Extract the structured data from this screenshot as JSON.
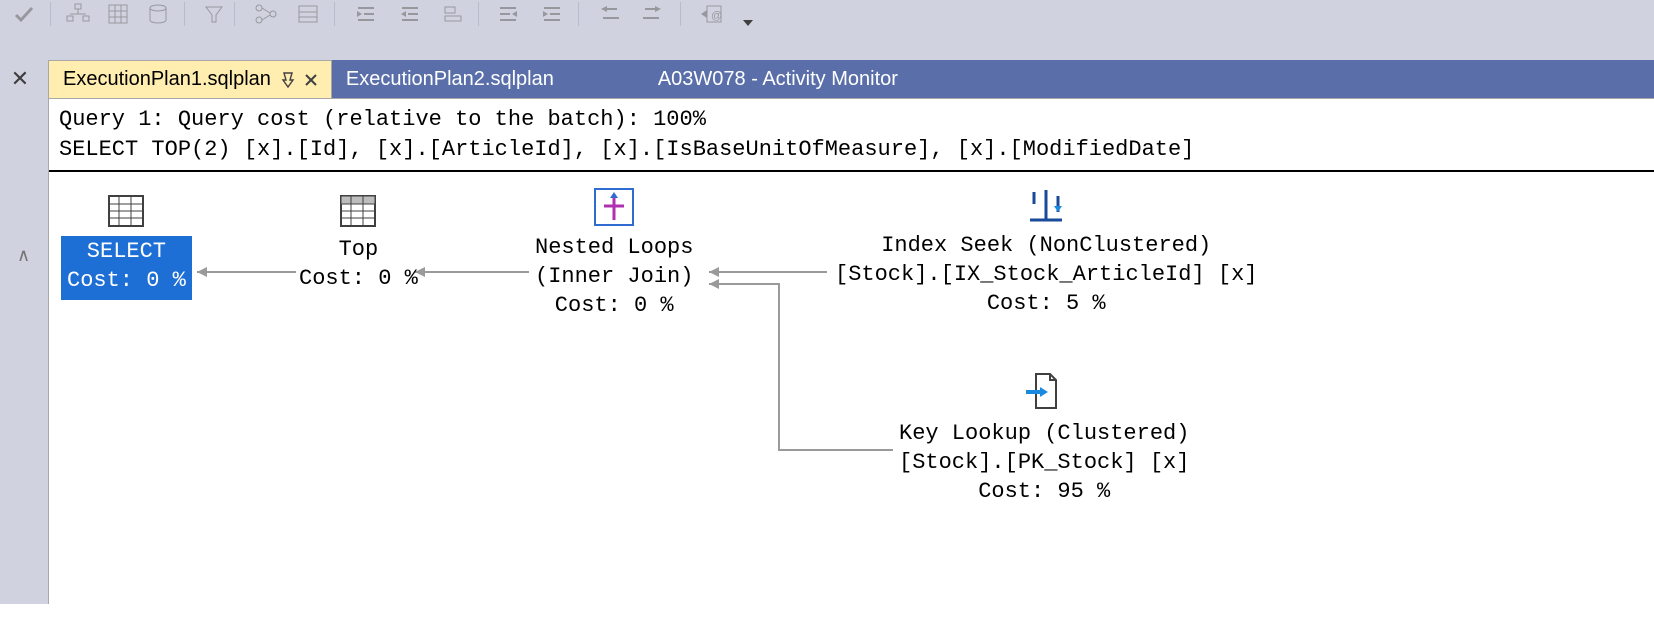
{
  "toolbar": {
    "icons": [
      "checkmark-icon",
      "hierarchy-icon",
      "grid-icon",
      "db-icon",
      "filter-icon",
      "tree-icon",
      "table-icon",
      "outdent-icon",
      "indent-icon",
      "align-left-icon",
      "align-right-icon",
      "arrow-left-small-icon",
      "arrow-right-small-icon",
      "arrow-right-circle-icon",
      "dropdown-caret-icon"
    ]
  },
  "tabs": [
    {
      "label": "ExecutionPlan1.sqlplan",
      "active": true,
      "pinned": true,
      "closable": true
    },
    {
      "label": "ExecutionPlan2.sqlplan",
      "active": false,
      "pinned": false,
      "closable": false
    },
    {
      "label": "A03W078 - Activity Monitor",
      "active": false,
      "pinned": false,
      "closable": false
    }
  ],
  "query": {
    "line1": "Query 1: Query cost (relative to the batch): 100%",
    "line2": "SELECT TOP(2) [x].[Id], [x].[ArticleId], [x].[IsBaseUnitOfMeasure], [x].[ModifiedDate]"
  },
  "nodes": {
    "select": {
      "title": "SELECT",
      "cost": "Cost: 0 %"
    },
    "top": {
      "title": "Top",
      "cost": "Cost: 0 %"
    },
    "nested": {
      "title": "Nested Loops",
      "sub": "(Inner Join)",
      "cost": "Cost: 0 %"
    },
    "indexseek": {
      "title": "Index Seek (NonClustered)",
      "obj": "[Stock].[IX_Stock_ArticleId] [x]",
      "cost": "Cost: 5 %"
    },
    "keylookup": {
      "title": "Key Lookup (Clustered)",
      "obj": "[Stock].[PK_Stock] [x]",
      "cost": "Cost: 95 %"
    }
  }
}
